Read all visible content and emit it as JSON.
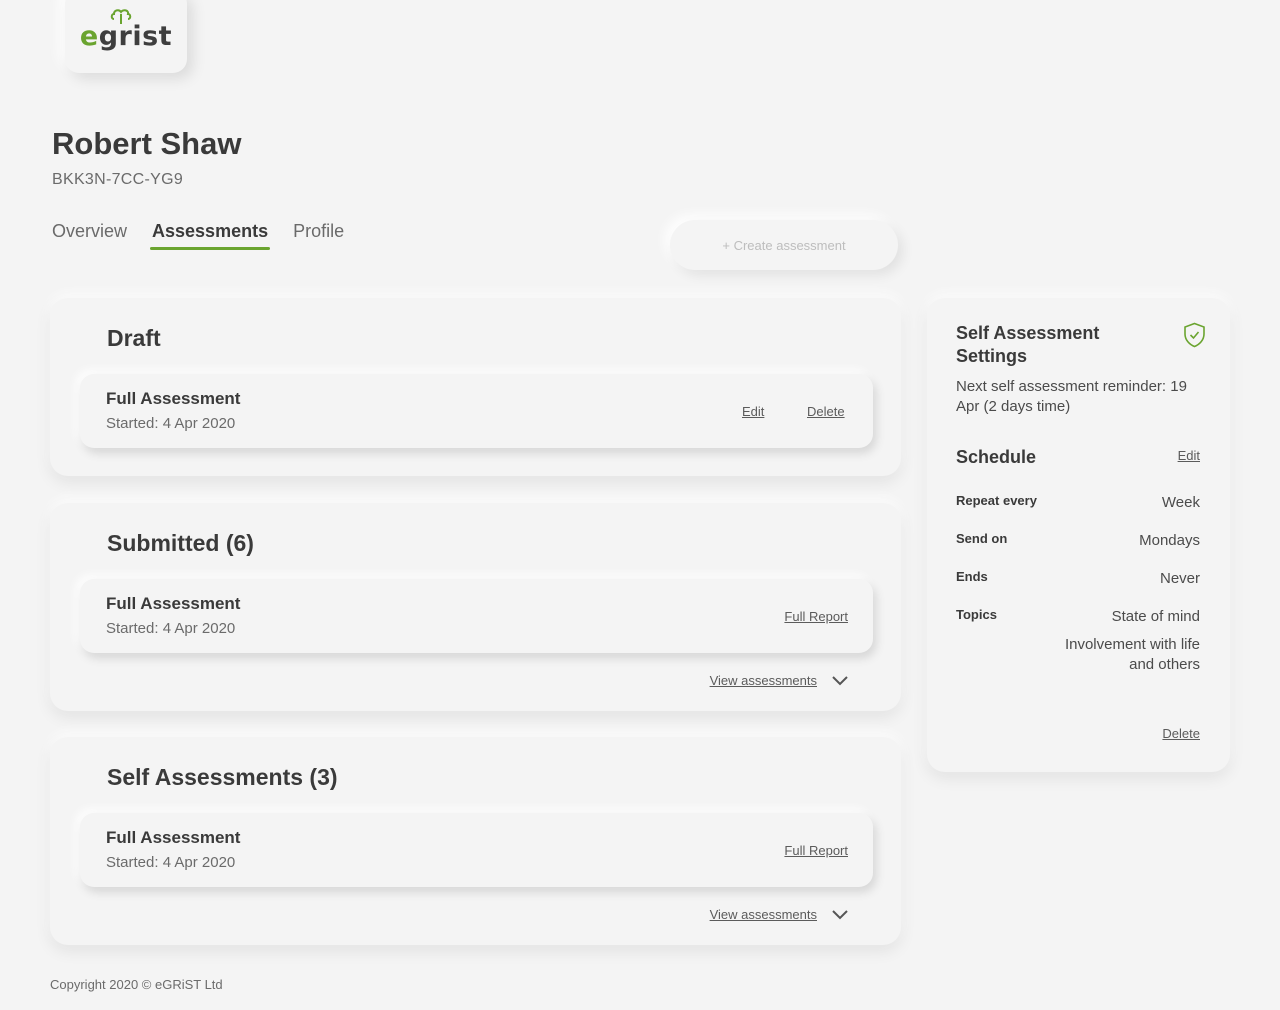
{
  "brand": {
    "logo_prefix": "e",
    "logo_suffix": "grist",
    "accent_color": "#6aa42f"
  },
  "user": {
    "name": "Robert Shaw",
    "id": "BKK3N-7CC-YG9"
  },
  "tabs": [
    {
      "label": "Overview",
      "active": false
    },
    {
      "label": "Assessments",
      "active": true
    },
    {
      "label": "Profile",
      "active": false
    }
  ],
  "create_button": {
    "label": "+ Create assessment"
  },
  "sections": {
    "draft": {
      "title": "Draft",
      "item": {
        "title": "Full Assessment",
        "started": "Started: 4 Apr 2020",
        "edit_label": "Edit",
        "delete_label": "Delete"
      }
    },
    "submitted": {
      "title": "Submitted (6)",
      "item": {
        "title": "Full Assessment",
        "started": "Started: 4 Apr 2020",
        "report_label": "Full Report"
      },
      "view_label": "View assessments"
    },
    "self": {
      "title": "Self Assessments (3)",
      "item": {
        "title": "Full Assessment",
        "started": "Started: 4 Apr 2020",
        "report_label": "Full Report"
      },
      "view_label": "View assessments"
    }
  },
  "settings": {
    "title": "Self Assessment Settings",
    "reminder": "Next self assessment reminder: 19 Apr (2 days time)",
    "schedule_title": "Schedule",
    "edit_label": "Edit",
    "rows": [
      {
        "key": "Repeat every",
        "value": "Week"
      },
      {
        "key": "Send on",
        "value": "Mondays"
      },
      {
        "key": "Ends",
        "value": "Never"
      },
      {
        "key": "Topics",
        "value": "State of mind"
      }
    ],
    "topic_extra": "Involvement with life and others",
    "delete_label": "Delete"
  },
  "footer": {
    "copyright": "Copyright 2020 © eGRiST Ltd"
  }
}
